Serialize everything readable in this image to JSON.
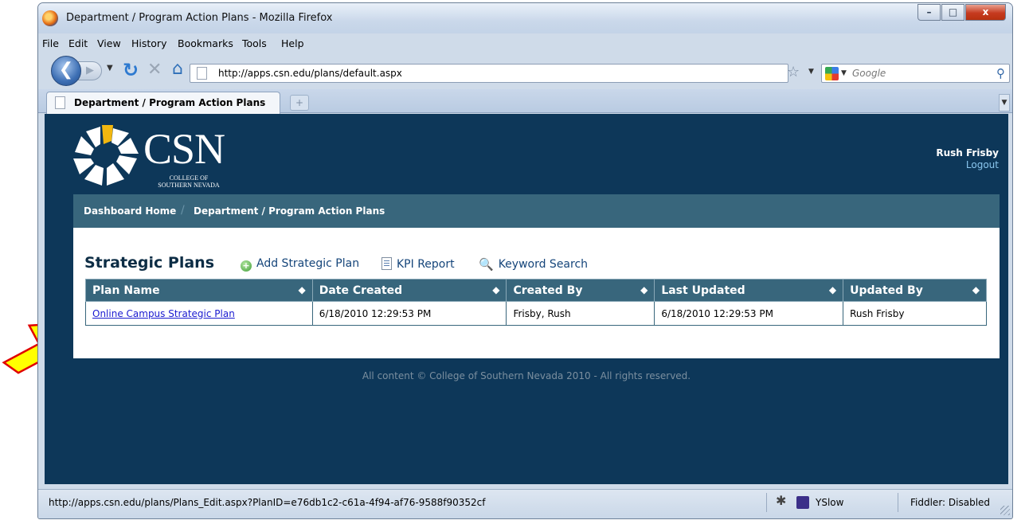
{
  "window": {
    "title": "Department / Program Action Plans - Mozilla Firefox",
    "controls": {
      "minimize": "–",
      "maximize": "□",
      "close": "x"
    }
  },
  "menu": [
    "File",
    "Edit",
    "View",
    "History",
    "Bookmarks",
    "Tools",
    "Help"
  ],
  "nav": {
    "url": "http://apps.csn.edu/plans/default.aspx",
    "search_placeholder": "Google"
  },
  "tab": {
    "label": "Department / Program Action Plans"
  },
  "site": {
    "logo_text": "CSN",
    "logo_sub_1": "COLLEGE OF",
    "logo_sub_2": "SOUTHERN NEVADA",
    "user_name": "Rush Frisby",
    "logout": "Logout"
  },
  "breadcrumb": {
    "home": "Dashboard Home",
    "separator": "/",
    "current": "Department / Program Action Plans"
  },
  "panel": {
    "title": "Strategic Plans",
    "actions": {
      "add": "Add Strategic Plan",
      "kpi": "KPI Report",
      "search": "Keyword Search"
    }
  },
  "table": {
    "headers": [
      "Plan Name",
      "Date Created",
      "Created By",
      "Last Updated",
      "Updated By"
    ],
    "rows": [
      [
        "Online Campus Strategic Plan",
        "6/18/2010 12:29:53 PM",
        "Frisby, Rush",
        "6/18/2010 12:29:53 PM",
        "Rush Frisby"
      ]
    ]
  },
  "footer": "All content © College of Southern Nevada 2010 - All rights reserved.",
  "status": {
    "url": "http://apps.csn.edu/plans/Plans_Edit.aspx?PlanID=e76db1c2-c61a-4f94-af76-9588f90352cf",
    "yslow": "YSlow",
    "fiddler": "Fiddler: Disabled"
  },
  "colors": {
    "page_background": "#0d3759",
    "header_bar": "#38667c",
    "link": "#1a1ad0",
    "callout_arrow": "#ffff00"
  }
}
